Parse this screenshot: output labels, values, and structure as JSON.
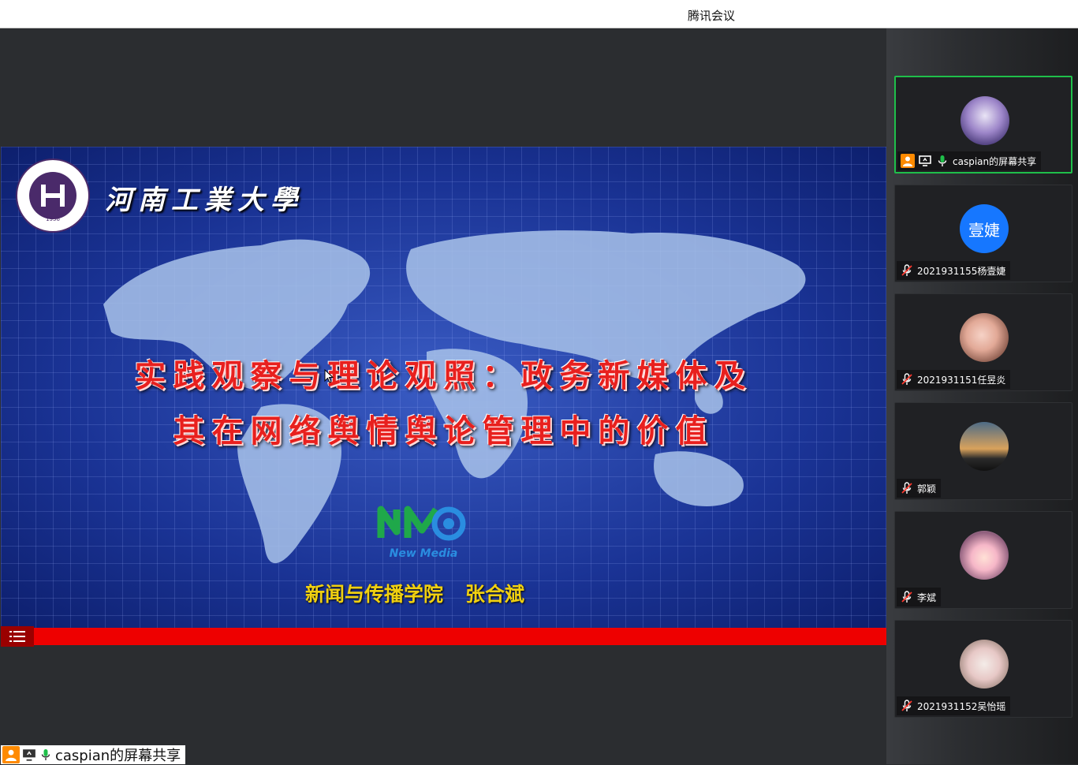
{
  "app": {
    "title": "腾讯会议"
  },
  "slide": {
    "university_name": "河南工業大學",
    "title_line1": "实践观察与理论观照：政务新媒体及",
    "title_line2": "其在网络舆情舆论管理中的价值",
    "author_dept": "新闻与传播学院",
    "author_name": "张合斌",
    "logo_text": "New Media"
  },
  "presenter": {
    "share_label": "caspian的屏幕共享"
  },
  "participants": [
    {
      "name": "caspian的屏幕共享",
      "avatar": "purple-anime-image",
      "muted": false,
      "sharing": true
    },
    {
      "name": "2021931155杨壹婕",
      "avatar_text": "壹婕",
      "muted": true
    },
    {
      "name": "2021931151任昱炎",
      "avatar": "girl-photo",
      "muted": true
    },
    {
      "name": "郭颖",
      "avatar": "sunset-silhouette",
      "muted": true
    },
    {
      "name": "李斌",
      "avatar": "anime-girl",
      "muted": true
    },
    {
      "name": "2021931152吴怡瑶",
      "avatar": "pink-photo",
      "muted": true
    }
  ],
  "colors": {
    "active_border": "#1fbf4a",
    "avatar_blue": "#1677ff",
    "slide_red": "#e8201e",
    "author_yellow": "#f0d010"
  }
}
